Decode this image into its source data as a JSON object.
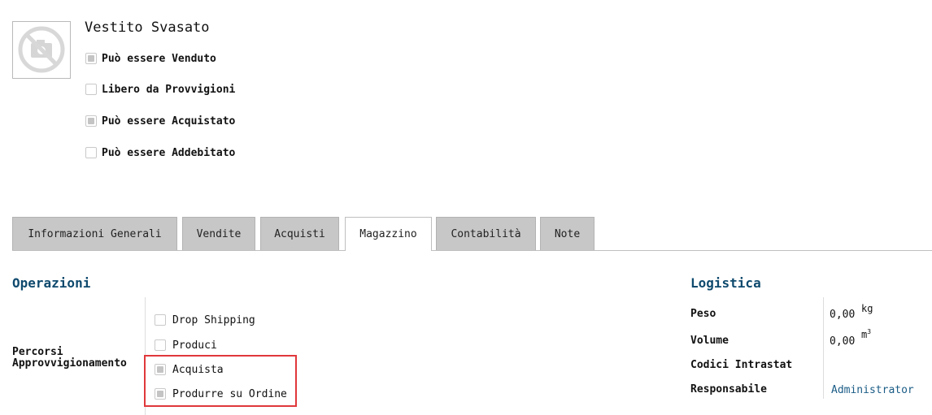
{
  "product": {
    "name": "Vestito Svasato",
    "flags": [
      {
        "label": "Può essere Venduto",
        "checked": true
      },
      {
        "label": "Libero da Provvigioni",
        "checked": false
      },
      {
        "label": "Può essere Acquistato",
        "checked": true
      },
      {
        "label": "Può essere Addebitato",
        "checked": false
      }
    ]
  },
  "tabs": [
    {
      "label": "Informazioni Generali",
      "active": false
    },
    {
      "label": "Vendite",
      "active": false
    },
    {
      "label": "Acquisti",
      "active": false
    },
    {
      "label": "Magazzino",
      "active": true
    },
    {
      "label": "Contabilità",
      "active": false
    },
    {
      "label": "Note",
      "active": false
    }
  ],
  "operations": {
    "title": "Operazioni",
    "routes_label": "Percorsi Approvvigionamento",
    "routes": [
      {
        "label": "Drop Shipping",
        "checked": false
      },
      {
        "label": "Produci",
        "checked": false
      },
      {
        "label": "Acquista",
        "checked": true
      },
      {
        "label": "Produrre su Ordine",
        "checked": true
      }
    ]
  },
  "logistics": {
    "title": "Logistica",
    "weight": {
      "label": "Peso",
      "value": "0,00",
      "unit": "kg"
    },
    "volume": {
      "label": "Volume",
      "value": "0,00",
      "unit": "m",
      "unit_exp": "3"
    },
    "intrastat": {
      "label": "Codici Intrastat",
      "value": ""
    },
    "responsible": {
      "label": "Responsabile",
      "value": "Administrator"
    }
  },
  "colors": {
    "section_title": "#0f4a6e",
    "link": "#1a5c86",
    "highlight": "#e0383b",
    "tab_inactive": "#c7c7c7"
  }
}
